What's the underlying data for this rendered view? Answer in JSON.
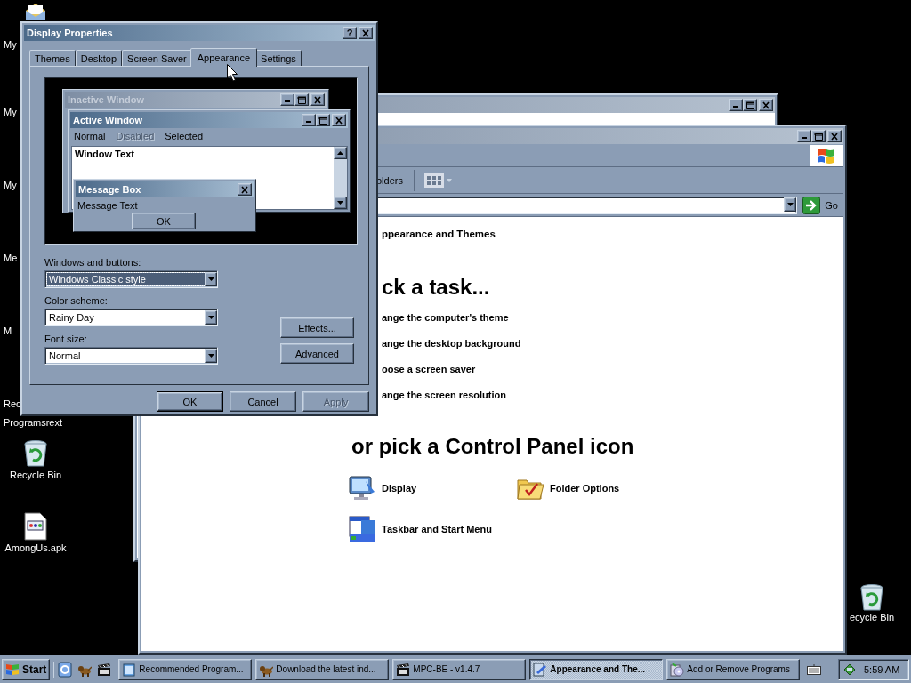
{
  "desktop_icons": [
    {
      "kind": "mail",
      "lines": [
        "My"
      ]
    },
    {
      "kind": "label_only",
      "lines": [
        "My"
      ]
    },
    {
      "kind": "label_only",
      "lines": [
        "My"
      ]
    },
    {
      "kind": "label_only",
      "lines": [
        "Me"
      ]
    },
    {
      "kind": "label_only",
      "lines": [
        "M"
      ]
    },
    {
      "kind": "label_only",
      "lines": [
        "Rec",
        "Programsrext"
      ]
    },
    {
      "kind": "recycle_bin",
      "lines": [
        "Recycle Bin"
      ]
    },
    {
      "kind": "apk_file",
      "lines": [
        "AmongUs.apk"
      ]
    }
  ],
  "right_icon": {
    "kind": "recycle_bin",
    "lines": [
      "ecycle Bin"
    ]
  },
  "explorer": {
    "toolbar_label": "olders",
    "go_label": "Go",
    "heading": "ppearance and Themes",
    "task_title": "ck a task...",
    "tasks": [
      "ange the computer's theme",
      "ange the desktop background",
      "oose a screen saver",
      "ange the screen resolution"
    ],
    "icons_title": "or pick a Control Panel icon",
    "icons": [
      {
        "kind": "display",
        "label": "Display"
      },
      {
        "kind": "folder",
        "label": "Folder Options"
      },
      {
        "kind": "taskbar",
        "label": "Taskbar and Start Menu"
      }
    ]
  },
  "dialog": {
    "title": "Display Properties",
    "help": "?",
    "tabs": [
      {
        "label": "Themes",
        "selected": false
      },
      {
        "label": "Desktop",
        "selected": false
      },
      {
        "label": "Screen Saver",
        "selected": false
      },
      {
        "label": "Appearance",
        "selected": true
      },
      {
        "label": "Settings",
        "selected": false
      }
    ],
    "preview": {
      "inactive_title": "Inactive Window",
      "active_title": "Active Window",
      "menu": [
        {
          "label": "Normal",
          "disabled": false
        },
        {
          "label": "Disabled",
          "disabled": true
        },
        {
          "label": "Selected",
          "disabled": false
        }
      ],
      "window_text": "Window Text",
      "message_title": "Message Box",
      "message_text": "Message Text",
      "message_button": "OK"
    },
    "fields": [
      {
        "label": "Windows and buttons:",
        "value": "Windows Classic style",
        "focused": true
      },
      {
        "label": "Color scheme:",
        "value": "Rainy Day",
        "focused": false
      },
      {
        "label": "Font size:",
        "value": "Normal",
        "focused": false
      }
    ],
    "side_buttons": [
      "Effects...",
      "Advanced"
    ],
    "buttons": [
      {
        "label": "OK",
        "default": true,
        "disabled": false
      },
      {
        "label": "Cancel",
        "default": false,
        "disabled": false
      },
      {
        "label": "Apply",
        "default": false,
        "disabled": true
      }
    ]
  },
  "taskbar": {
    "start": "Start",
    "tasks": [
      {
        "label": "Recommended Program...",
        "selected": false
      },
      {
        "label": "Download the latest ind...",
        "selected": false
      },
      {
        "label": "MPC-BE - v1.4.7",
        "selected": false
      },
      {
        "label": "Appearance and The...",
        "selected": true
      },
      {
        "label": "Add or Remove Programs",
        "selected": false
      }
    ],
    "clock": "5:59 AM"
  }
}
